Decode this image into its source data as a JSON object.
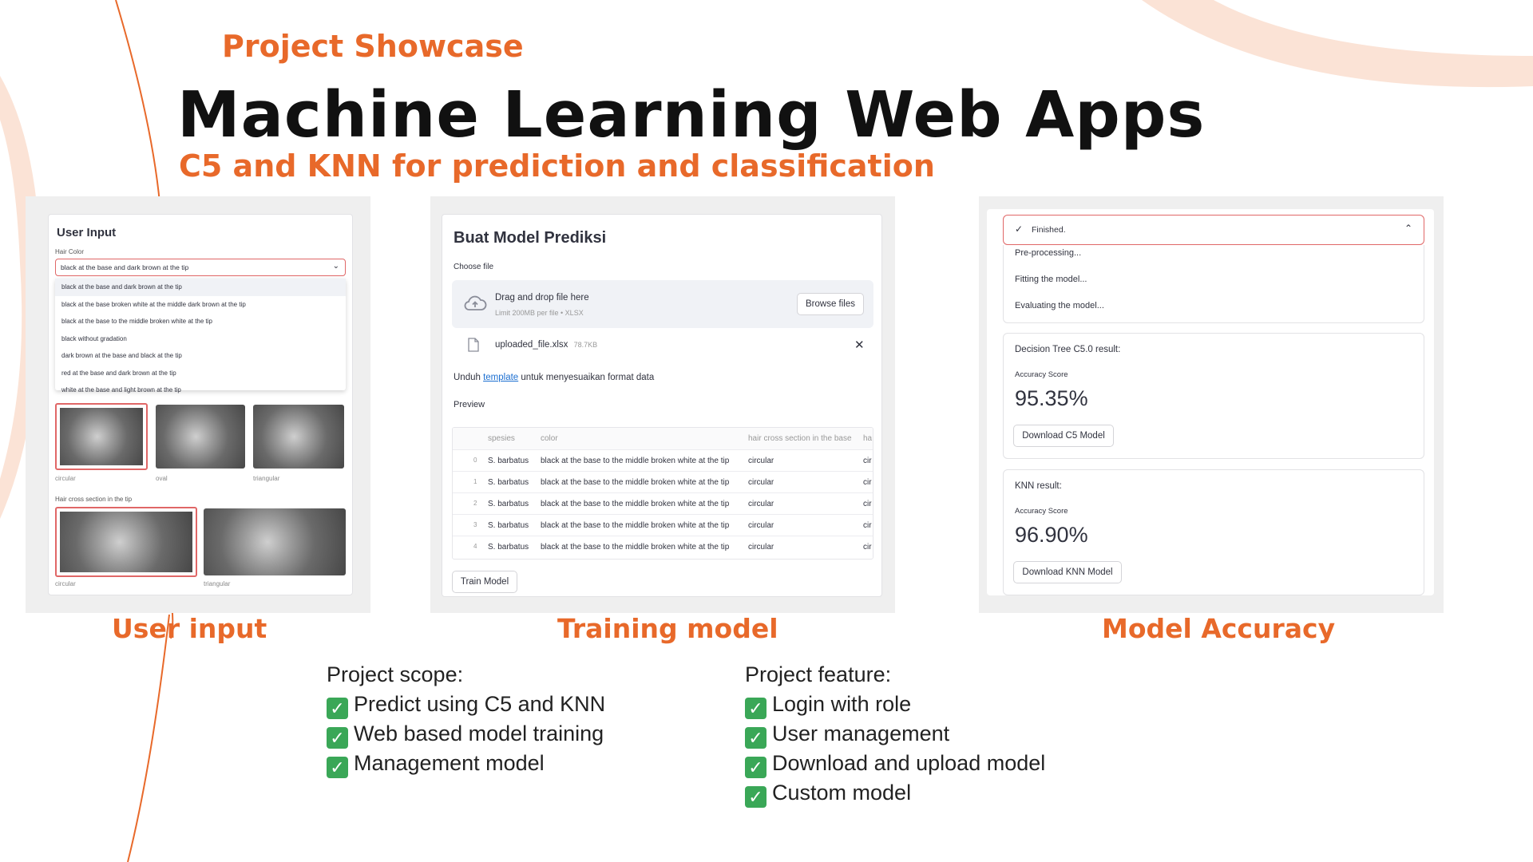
{
  "header": {
    "eyebrow": "Project Showcase",
    "title": "Machine Learning Web Apps",
    "subtitle": "C5 and KNN for prediction and classification"
  },
  "colors": {
    "accent": "#e8692a",
    "highlight_border": "#e06767",
    "check": "#3aa757"
  },
  "user_input_panel": {
    "heading": "User Input",
    "hair_color_label": "Hair Color",
    "selected_value": "black at the base and dark brown at the tip",
    "options": [
      "black at the base and dark brown at the tip",
      "black at the base broken white at the middle dark brown at the tip",
      "black at the base to the middle broken white at the tip",
      "black without gradation",
      "dark brown at the base and black at the tip",
      "red at the base and dark brown at the tip",
      "white at the base and light brown at the tip"
    ],
    "base_images": [
      "circular",
      "oval",
      "triangular"
    ],
    "tip_label": "Hair cross section in the tip",
    "tip_images": [
      "circular",
      "triangular"
    ]
  },
  "training_panel": {
    "heading": "Buat Model Prediksi",
    "choose_file": "Choose file",
    "drop_text": "Drag and drop file here",
    "limit_text": "Limit 200MB per file • XLSX",
    "browse_label": "Browse files",
    "file_name": "uploaded_file.xlsx",
    "file_size": "78.7KB",
    "unduh_pre": "Unduh",
    "unduh_link": "template",
    "unduh_post": "untuk menyesuaikan format data",
    "preview_label": "Preview",
    "columns": [
      "",
      "spesies",
      "color",
      "hair cross section in the base",
      "ha"
    ],
    "rows": [
      [
        "0",
        "S. barbatus",
        "black at the base to the middle broken white at the tip",
        "circular",
        "cir"
      ],
      [
        "1",
        "S. barbatus",
        "black at the base to the middle broken white at the tip",
        "circular",
        "cir"
      ],
      [
        "2",
        "S. barbatus",
        "black at the base to the middle broken white at the tip",
        "circular",
        "cir"
      ],
      [
        "3",
        "S. barbatus",
        "black at the base to the middle broken white at the tip",
        "circular",
        "cir"
      ],
      [
        "4",
        "S. barbatus",
        "black at the base to the middle broken white at the tip",
        "circular",
        "cir"
      ]
    ],
    "train_label": "Train Model"
  },
  "accuracy_panel": {
    "status": "Finished.",
    "steps": [
      "Pre-processing...",
      "Fitting the model...",
      "Evaluating the model..."
    ],
    "c5": {
      "title": "Decision Tree C5.0 result:",
      "label": "Accuracy Score",
      "value": "95.35%",
      "button": "Download C5 Model"
    },
    "knn": {
      "title": "KNN result:",
      "label": "Accuracy Score",
      "value": "96.90%",
      "button": "Download KNN Model"
    }
  },
  "captions": {
    "user_input": "User input",
    "training": "Training model",
    "accuracy": "Model Accuracy"
  },
  "scope": {
    "heading": "Project scope:",
    "items": [
      "Predict using C5 and KNN",
      "Web based model training",
      "Management model"
    ]
  },
  "features": {
    "heading": "Project feature:",
    "items": [
      "Login with role",
      "User management",
      "Download and upload model",
      "Custom model"
    ]
  }
}
